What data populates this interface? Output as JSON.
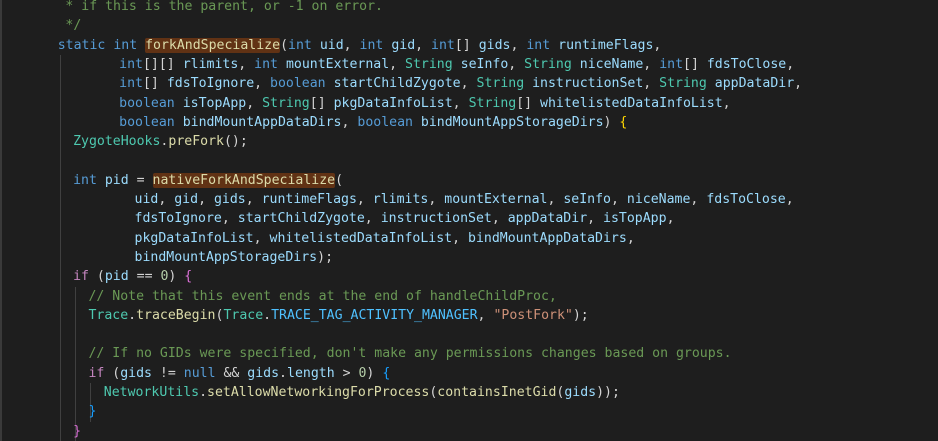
{
  "colors": {
    "background": "#1e1e1e",
    "keyword": "#569cd6",
    "control": "#c586c0",
    "type": "#4ec9b0",
    "function": "#dcdcaa",
    "parameter": "#9cdcfe",
    "comment": "#6a9955",
    "string": "#ce9178",
    "number": "#b5cea8",
    "highlight": "#613214"
  },
  "lines": [
    {
      "indent": 5,
      "tokens": [
        [
          "comment",
          "* if this is the parent, or -1 on error."
        ]
      ]
    },
    {
      "indent": 5,
      "tokens": [
        [
          "comment",
          "*/"
        ]
      ]
    },
    {
      "indent": 4,
      "tokens": [
        [
          "keyword",
          "static"
        ],
        [
          "plain",
          " "
        ],
        [
          "keyword",
          "int"
        ],
        [
          "plain",
          " "
        ],
        [
          "func-highlight",
          "forkAndSpecialize"
        ],
        [
          "plain",
          "("
        ],
        [
          "keyword",
          "int"
        ],
        [
          "plain",
          " "
        ],
        [
          "param",
          "uid"
        ],
        [
          "plain",
          ", "
        ],
        [
          "keyword",
          "int"
        ],
        [
          "plain",
          " "
        ],
        [
          "param",
          "gid"
        ],
        [
          "plain",
          ", "
        ],
        [
          "keyword",
          "int"
        ],
        [
          "plain",
          "[] "
        ],
        [
          "param",
          "gids"
        ],
        [
          "plain",
          ", "
        ],
        [
          "keyword",
          "int"
        ],
        [
          "plain",
          " "
        ],
        [
          "param",
          "runtimeFlags"
        ],
        [
          "plain",
          ","
        ]
      ]
    },
    {
      "indent": 12,
      "tokens": [
        [
          "keyword",
          "int"
        ],
        [
          "plain",
          "[][] "
        ],
        [
          "param",
          "rlimits"
        ],
        [
          "plain",
          ", "
        ],
        [
          "keyword",
          "int"
        ],
        [
          "plain",
          " "
        ],
        [
          "param",
          "mountExternal"
        ],
        [
          "plain",
          ", "
        ],
        [
          "type",
          "String"
        ],
        [
          "plain",
          " "
        ],
        [
          "param",
          "seInfo"
        ],
        [
          "plain",
          ", "
        ],
        [
          "type",
          "String"
        ],
        [
          "plain",
          " "
        ],
        [
          "param",
          "niceName"
        ],
        [
          "plain",
          ", "
        ],
        [
          "keyword",
          "int"
        ],
        [
          "plain",
          "[] "
        ],
        [
          "param",
          "fdsToClose"
        ],
        [
          "plain",
          ","
        ]
      ]
    },
    {
      "indent": 12,
      "tokens": [
        [
          "keyword",
          "int"
        ],
        [
          "plain",
          "[] "
        ],
        [
          "param",
          "fdsToIgnore"
        ],
        [
          "plain",
          ", "
        ],
        [
          "keyword",
          "boolean"
        ],
        [
          "plain",
          " "
        ],
        [
          "param",
          "startChildZygote"
        ],
        [
          "plain",
          ", "
        ],
        [
          "type",
          "String"
        ],
        [
          "plain",
          " "
        ],
        [
          "param",
          "instructionSet"
        ],
        [
          "plain",
          ", "
        ],
        [
          "type",
          "String"
        ],
        [
          "plain",
          " "
        ],
        [
          "param",
          "appDataDir"
        ],
        [
          "plain",
          ","
        ]
      ]
    },
    {
      "indent": 12,
      "tokens": [
        [
          "keyword",
          "boolean"
        ],
        [
          "plain",
          " "
        ],
        [
          "param",
          "isTopApp"
        ],
        [
          "plain",
          ", "
        ],
        [
          "type",
          "String"
        ],
        [
          "plain",
          "[] "
        ],
        [
          "param",
          "pkgDataInfoList"
        ],
        [
          "plain",
          ", "
        ],
        [
          "type",
          "String"
        ],
        [
          "plain",
          "[] "
        ],
        [
          "param",
          "whitelistedDataInfoList"
        ],
        [
          "plain",
          ","
        ]
      ]
    },
    {
      "indent": 12,
      "tokens": [
        [
          "keyword",
          "boolean"
        ],
        [
          "plain",
          " "
        ],
        [
          "param",
          "bindMountAppDataDirs"
        ],
        [
          "plain",
          ", "
        ],
        [
          "keyword",
          "boolean"
        ],
        [
          "plain",
          " "
        ],
        [
          "param",
          "bindMountAppStorageDirs"
        ],
        [
          "plain",
          ") "
        ],
        [
          "brace1",
          "{"
        ]
      ]
    },
    {
      "indent": 6,
      "tokens": [
        [
          "type",
          "ZygoteHooks"
        ],
        [
          "plain",
          "."
        ],
        [
          "func",
          "preFork"
        ],
        [
          "plain",
          "();"
        ]
      ]
    },
    {
      "indent": 0,
      "tokens": []
    },
    {
      "indent": 6,
      "tokens": [
        [
          "keyword",
          "int"
        ],
        [
          "plain",
          " "
        ],
        [
          "param",
          "pid"
        ],
        [
          "plain",
          " = "
        ],
        [
          "func-highlight",
          "nativeForkAndSpecialize"
        ],
        [
          "plain",
          "("
        ]
      ]
    },
    {
      "indent": 14,
      "tokens": [
        [
          "param",
          "uid"
        ],
        [
          "plain",
          ", "
        ],
        [
          "param",
          "gid"
        ],
        [
          "plain",
          ", "
        ],
        [
          "param",
          "gids"
        ],
        [
          "plain",
          ", "
        ],
        [
          "param",
          "runtimeFlags"
        ],
        [
          "plain",
          ", "
        ],
        [
          "param",
          "rlimits"
        ],
        [
          "plain",
          ", "
        ],
        [
          "param",
          "mountExternal"
        ],
        [
          "plain",
          ", "
        ],
        [
          "param",
          "seInfo"
        ],
        [
          "plain",
          ", "
        ],
        [
          "param",
          "niceName"
        ],
        [
          "plain",
          ", "
        ],
        [
          "param",
          "fdsToClose"
        ],
        [
          "plain",
          ","
        ]
      ]
    },
    {
      "indent": 14,
      "tokens": [
        [
          "param",
          "fdsToIgnore"
        ],
        [
          "plain",
          ", "
        ],
        [
          "param",
          "startChildZygote"
        ],
        [
          "plain",
          ", "
        ],
        [
          "param",
          "instructionSet"
        ],
        [
          "plain",
          ", "
        ],
        [
          "param",
          "appDataDir"
        ],
        [
          "plain",
          ", "
        ],
        [
          "param",
          "isTopApp"
        ],
        [
          "plain",
          ","
        ]
      ]
    },
    {
      "indent": 14,
      "tokens": [
        [
          "param",
          "pkgDataInfoList"
        ],
        [
          "plain",
          ", "
        ],
        [
          "param",
          "whitelistedDataInfoList"
        ],
        [
          "plain",
          ", "
        ],
        [
          "param",
          "bindMountAppDataDirs"
        ],
        [
          "plain",
          ","
        ]
      ]
    },
    {
      "indent": 14,
      "tokens": [
        [
          "param",
          "bindMountAppStorageDirs"
        ],
        [
          "plain",
          ");"
        ]
      ]
    },
    {
      "indent": 6,
      "tokens": [
        [
          "control",
          "if"
        ],
        [
          "plain",
          " ("
        ],
        [
          "param",
          "pid"
        ],
        [
          "plain",
          " == "
        ],
        [
          "number",
          "0"
        ],
        [
          "plain",
          ") "
        ],
        [
          "brace2",
          "{"
        ]
      ]
    },
    {
      "indent": 8,
      "tokens": [
        [
          "comment",
          "// Note that this event ends at the end of handleChildProc,"
        ]
      ]
    },
    {
      "indent": 8,
      "tokens": [
        [
          "type",
          "Trace"
        ],
        [
          "plain",
          "."
        ],
        [
          "func",
          "traceBegin"
        ],
        [
          "plain",
          "("
        ],
        [
          "type",
          "Trace"
        ],
        [
          "plain",
          "."
        ],
        [
          "const",
          "TRACE_TAG_ACTIVITY_MANAGER"
        ],
        [
          "plain",
          ", "
        ],
        [
          "string",
          "\"PostFork\""
        ],
        [
          "plain",
          ");"
        ]
      ]
    },
    {
      "indent": 0,
      "tokens": []
    },
    {
      "indent": 8,
      "tokens": [
        [
          "comment",
          "// If no GIDs were specified, don't make any permissions changes based on groups."
        ]
      ]
    },
    {
      "indent": 8,
      "tokens": [
        [
          "control",
          "if"
        ],
        [
          "plain",
          " ("
        ],
        [
          "param",
          "gids"
        ],
        [
          "plain",
          " != "
        ],
        [
          "keyword",
          "null"
        ],
        [
          "plain",
          " && "
        ],
        [
          "param",
          "gids"
        ],
        [
          "plain",
          "."
        ],
        [
          "param",
          "length"
        ],
        [
          "plain",
          " > "
        ],
        [
          "number",
          "0"
        ],
        [
          "plain",
          ") "
        ],
        [
          "brace3",
          "{"
        ]
      ]
    },
    {
      "indent": 10,
      "tokens": [
        [
          "type",
          "NetworkUtils"
        ],
        [
          "plain",
          "."
        ],
        [
          "func",
          "setAllowNetworkingForProcess"
        ],
        [
          "plain",
          "("
        ],
        [
          "func",
          "containsInetGid"
        ],
        [
          "plain",
          "("
        ],
        [
          "param",
          "gids"
        ],
        [
          "plain",
          "));"
        ]
      ]
    },
    {
      "indent": 8,
      "tokens": [
        [
          "brace3",
          "}"
        ]
      ]
    },
    {
      "indent": 6,
      "tokens": [
        [
          "brace2",
          "}"
        ]
      ]
    }
  ]
}
